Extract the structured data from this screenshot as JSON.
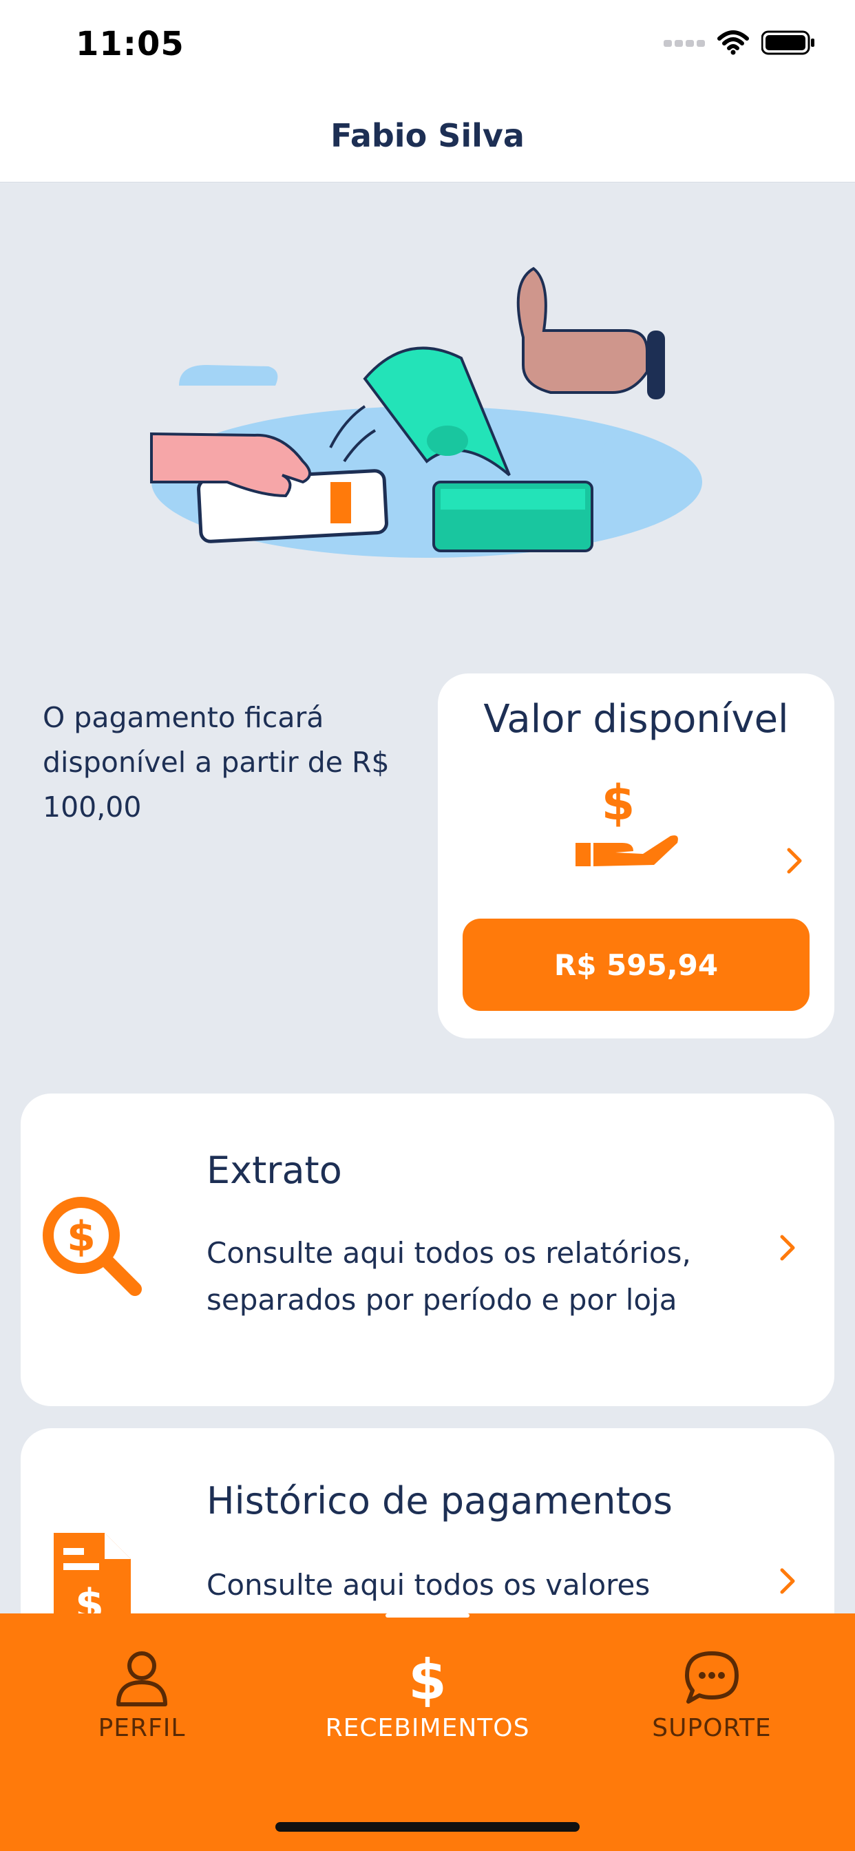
{
  "status_bar": {
    "time": "11:05"
  },
  "header": {
    "title": "Fabio Silva"
  },
  "info": {
    "text": "O pagamento ficará disponível a partir de R$ 100,00"
  },
  "balance_card": {
    "title": "Valor disponível",
    "amount": "R$ 595,94",
    "accent_color": "#ff7a0b"
  },
  "cards": [
    {
      "title": "Extrato",
      "description": "Consulte aqui todos os relatórios, separados por período e por loja",
      "icon": "search-dollar-icon"
    },
    {
      "title": "Histórico de pagamentos",
      "description": "Consulte aqui todos os valores pagos",
      "icon": "document-dollar-icon"
    }
  ],
  "tab_bar": {
    "tabs": [
      {
        "label": "PERFIL",
        "icon": "person-icon",
        "active": false
      },
      {
        "label": "RECEBIMENTOS",
        "icon": "dollar-icon",
        "active": true
      },
      {
        "label": "SUPORTE",
        "icon": "chat-bubble-icon",
        "active": false
      }
    ]
  }
}
